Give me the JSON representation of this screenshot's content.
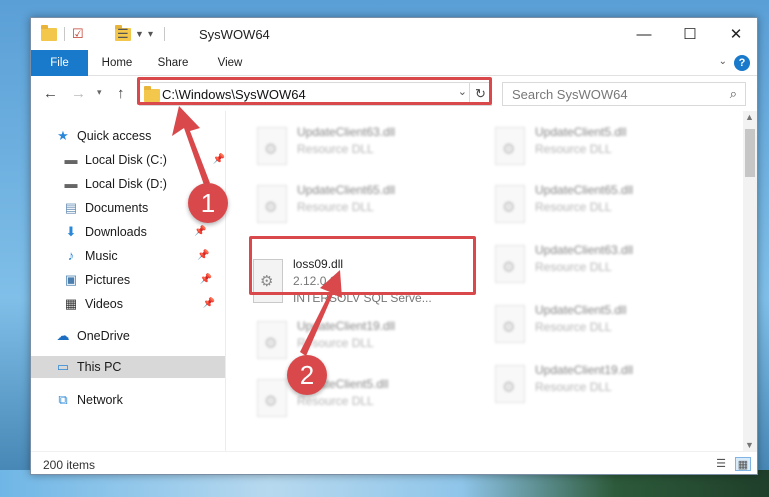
{
  "window": {
    "title": "SysWOW64"
  },
  "ribbon": {
    "tabs": [
      {
        "label": "File"
      },
      {
        "label": "Home"
      },
      {
        "label": "Share"
      },
      {
        "label": "View"
      }
    ]
  },
  "address": {
    "path": "C:\\Windows\\SysWOW64"
  },
  "search": {
    "placeholder": "Search SysWOW64"
  },
  "nav": {
    "items": [
      {
        "label": "Quick access",
        "icon": "star-icon"
      },
      {
        "label": "Local Disk (C:)",
        "icon": "drive-icon"
      },
      {
        "label": "Local Disk (D:)",
        "icon": "drive-icon"
      },
      {
        "label": "Documents",
        "icon": "documents-icon"
      },
      {
        "label": "Downloads",
        "icon": "download-icon"
      },
      {
        "label": "Music",
        "icon": "music-icon"
      },
      {
        "label": "Pictures",
        "icon": "pictures-icon"
      },
      {
        "label": "Videos",
        "icon": "videos-icon"
      },
      {
        "label": "OneDrive",
        "icon": "cloud-icon"
      },
      {
        "label": "This PC",
        "icon": "computer-icon"
      },
      {
        "label": "Network",
        "icon": "network-icon"
      }
    ]
  },
  "files": {
    "left": [
      {
        "name": "UpdateClient63.dll",
        "type": "Resource DLL"
      },
      {
        "name": "UpdateClient65.dll",
        "type": "Resource DLL"
      },
      {
        "name": "loss09.dll",
        "version": "2.12.0.0",
        "company": "INTERSOLV SQL Serve..."
      },
      {
        "name": "UpdateClient19.dll",
        "type": "Resource DLL"
      },
      {
        "name": "UpdateClient5.dll",
        "type": "Resource DLL"
      }
    ],
    "right": [
      {
        "name": "UpdateClient5.dll",
        "type": "Resource DLL"
      },
      {
        "name": "UpdateClient65.dll",
        "type": "Resource DLL"
      },
      {
        "name": "UpdateClient63.dll",
        "type": "Resource DLL"
      },
      {
        "name": "UpdateClient5.dll",
        "type": "Resource DLL"
      },
      {
        "name": "UpdateClient19.dll",
        "type": "Resource DLL"
      }
    ]
  },
  "status": {
    "item_count": "200 items"
  },
  "callouts": {
    "one": "1",
    "two": "2"
  },
  "colors": {
    "accent": "#1979ca",
    "highlight": "#d9484a"
  }
}
